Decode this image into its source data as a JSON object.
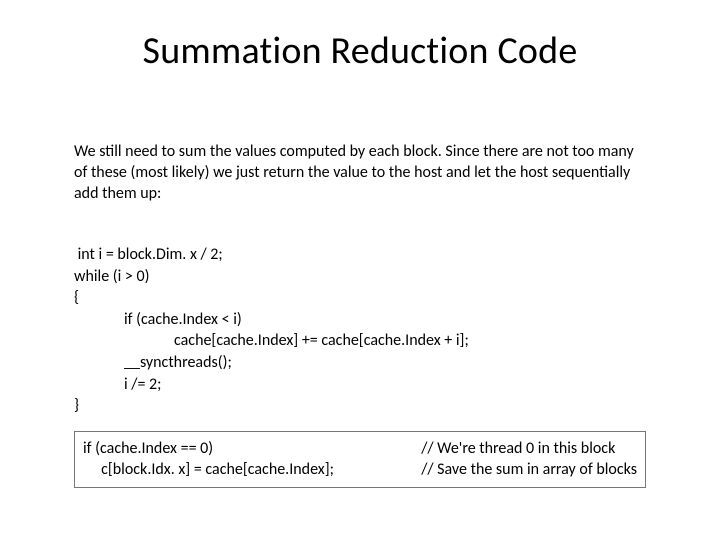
{
  "title": "Summation Reduction Code",
  "paragraph": "We still need to sum the values computed by each block.  Since there are not too many of these (most likely) we just return the value to the host and let the host sequentially add them up:",
  "code": {
    "l1": " int i = block.Dim. x / 2;",
    "l2": "while (i > 0)",
    "l3": "{",
    "l4": "if (cache.Index < i)",
    "l5": "cache[cache.Index] += cache[cache.Index + i];",
    "l6": "__syncthreads();",
    "l7": "i /= 2;",
    "l8": "}"
  },
  "boxed": {
    "left1": "if (cache.Index == 0)",
    "left2": "     c[block.Idx. x] = cache[cache.Index];",
    "right1": "// We're thread 0 in this block",
    "right2": "// Save the sum in array of blocks"
  }
}
